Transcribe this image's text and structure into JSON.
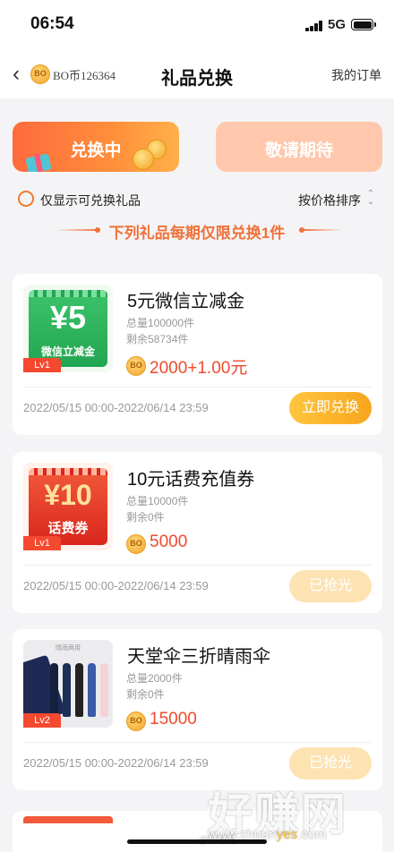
{
  "status_bar": {
    "time": "06:54",
    "network": "5G"
  },
  "nav": {
    "coin_icon": "BO",
    "bo_balance": "BO币126364",
    "title": "礼品兑换",
    "my_orders": "我的订单"
  },
  "tabs": [
    {
      "label": "兑换中",
      "active": true
    },
    {
      "label": "敬请期待",
      "active": false
    }
  ],
  "filter": {
    "only_redeemable_label": "仅显示可兑换礼品",
    "checked": false
  },
  "sort": {
    "label": "按价格排序"
  },
  "notice": "下列礼品每期仅限兑换1件",
  "items": [
    {
      "thumb_big": "¥5",
      "thumb_caption": "微信立减金",
      "level": "Lv1",
      "name": "5元微信立减金",
      "total": "总量100000件",
      "remaining": "剩余58734件",
      "coin_icon": "BO",
      "price": "2000+1.00元",
      "period": "2022/05/15 00:00-2022/06/14 23:59",
      "action": "立即兑换",
      "action_state": "active"
    },
    {
      "thumb_big": "¥10",
      "thumb_caption": "话费券",
      "level": "Lv1",
      "name": "10元话费充值券",
      "total": "总量10000件",
      "remaining": "剩余0件",
      "coin_icon": "BO",
      "price": "5000",
      "period": "2022/05/15 00:00-2022/06/14 23:59",
      "action": "已抢光",
      "action_state": "sold_out"
    },
    {
      "thumb_caption": "晴雨两用",
      "level": "Lv2",
      "name": "天堂伞三折晴雨伞",
      "total": "总量2000件",
      "remaining": "剩余0件",
      "coin_icon": "BO",
      "price": "15000",
      "period": "2022/05/15 00:00-2022/06/14 23:59",
      "action": "已抢光",
      "action_state": "sold_out"
    }
  ],
  "watermark": {
    "text": "好赚网",
    "url_prefix": "www.zhuan",
    "url_highlight": "yes",
    "url_suffix": ".com",
    "weibo": "@好赚网"
  },
  "colors": {
    "accent_orange": "#f0713a",
    "price_red": "#ef4a2d",
    "button_gold": "#f7a51c",
    "sold_out": "#fde3b2"
  }
}
